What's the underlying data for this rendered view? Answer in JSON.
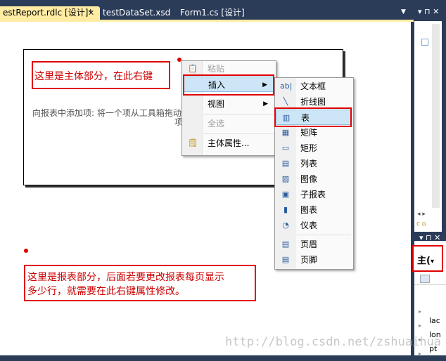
{
  "tabs": [
    {
      "label": "estReport.rdlc [设计]*",
      "active": true,
      "close": "✕"
    },
    {
      "label": "testDataSet.xsd",
      "active": false
    },
    {
      "label": "Form1.cs [设计]",
      "active": false
    }
  ],
  "tab_overflow": "▼",
  "annotations": {
    "body_note": "这里是主体部分，在此右键",
    "report_note_line1": "这里是报表部分，后面若要更改报表每页显示",
    "report_note_line2": "多少行，就需要在此右键属性修改。"
  },
  "report_body_hint": "向报表中添加项: 将一个项从工具箱拖动",
  "report_body_hint_tail": "项",
  "context_menu": {
    "items": [
      {
        "label": "粘贴",
        "icon": "paste-icon",
        "disabled": true
      },
      {
        "label": "插入",
        "icon": "",
        "submenu": true,
        "highlighted": true
      },
      {
        "label": "视图",
        "icon": "",
        "submenu": true
      },
      {
        "label": "全选",
        "icon": "",
        "disabled": true
      },
      {
        "label": "主体属性...",
        "icon": "properties-icon"
      }
    ],
    "submenu_arrow": "▶"
  },
  "insert_submenu": {
    "items": [
      {
        "label": "文本框",
        "icon": "textbox-icon",
        "glyph": "ab|"
      },
      {
        "label": "折线图",
        "icon": "line-icon",
        "glyph": "╲"
      },
      {
        "label": "表",
        "icon": "table-icon",
        "glyph": "▥",
        "highlighted": true
      },
      {
        "label": "矩阵",
        "icon": "matrix-icon",
        "glyph": "▦"
      },
      {
        "label": "矩形",
        "icon": "rectangle-icon",
        "glyph": "▭"
      },
      {
        "label": "列表",
        "icon": "list-icon",
        "glyph": "▤"
      },
      {
        "label": "图像",
        "icon": "image-icon",
        "glyph": "▨"
      },
      {
        "label": "子报表",
        "icon": "subreport-icon",
        "glyph": "▣"
      },
      {
        "label": "图表",
        "icon": "chart-icon",
        "glyph": "▮"
      },
      {
        "label": "仪表",
        "icon": "gauge-icon",
        "glyph": "◔"
      },
      {
        "label": "页眉",
        "icon": "page-header-icon",
        "glyph": "▤"
      },
      {
        "label": "页脚",
        "icon": "page-footer-icon",
        "glyph": "▤"
      }
    ]
  },
  "right_panel": {
    "pin": "▾ ⊓ ✕",
    "pin2": "▾ ⊓ ✕",
    "selector_text": "主(",
    "selector_arrow": "▾",
    "props": [
      "lac",
      "lon",
      "pt"
    ]
  },
  "watermark": "http://blog.csdn.net/zshuaihua"
}
